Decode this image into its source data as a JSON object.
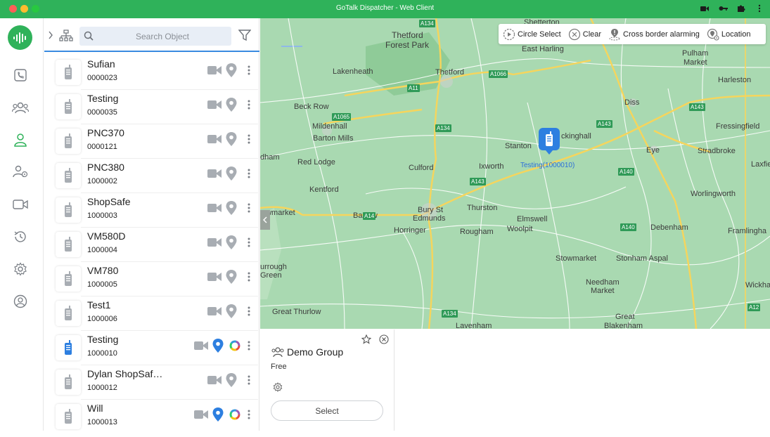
{
  "window": {
    "title": "GoTalk Dispatcher - Web Client"
  },
  "search": {
    "placeholder": "Search Object"
  },
  "objects": [
    {
      "name": "Sufian",
      "id": "0000023",
      "online": false
    },
    {
      "name": "Testing",
      "id": "0000035",
      "online": false
    },
    {
      "name": "PNC370",
      "id": "0000121",
      "online": false
    },
    {
      "name": "PNC380",
      "id": "1000002",
      "online": false
    },
    {
      "name": "ShopSafe",
      "id": "1000003",
      "online": false
    },
    {
      "name": "VM580D",
      "id": "1000004",
      "online": false
    },
    {
      "name": "VM780",
      "id": "1000005",
      "online": false
    },
    {
      "name": "Test1",
      "id": "1000006",
      "online": false
    },
    {
      "name": "Testing",
      "id": "1000010",
      "online": true
    },
    {
      "name": "Dylan ShopSaf…",
      "id": "1000012",
      "online": false
    },
    {
      "name": "Will",
      "id": "1000013",
      "online": true
    }
  ],
  "map_toolbar": {
    "circle_select": "Circle Select",
    "clear": "Clear",
    "cross_border": "Cross border alarming",
    "location": "Location"
  },
  "map_marker": {
    "label": "Testing(1000010)"
  },
  "map_places": [
    "Shetterton",
    "Thetford",
    "Forest Park",
    "East Harling",
    "Pulham",
    "Market",
    "Lakenheath",
    "Thetford",
    "Harleston",
    "Beck Row",
    "Diss",
    "Mildenhall",
    "Barton Mills",
    "Fressingfield",
    "Stanton",
    "ckinghall",
    "Eye",
    "Stradbroke",
    "dham",
    "Red Lodge",
    "Culford",
    "Ixworth",
    "Laxfie",
    "Kentford",
    "Worlingworth",
    "Barrow",
    "Thurston",
    "Bury St",
    "Edmunds",
    "Elmswell",
    "ewmarket",
    "Horringer",
    "Rougham",
    "Woolpit",
    "Debenham",
    "Framlingha",
    "Stowmarket",
    "Stonham Aspal",
    "urrough",
    "Green",
    "Needham",
    "Market",
    "Wickha",
    "Great Thurlow",
    "Great",
    "Blakenham",
    "Lavenham"
  ],
  "map_roads": [
    "A134",
    "A1066",
    "A11",
    "A1065",
    "A134",
    "A143",
    "A143",
    "A143",
    "A140",
    "A14",
    "A140",
    "A134",
    "A12"
  ],
  "group_card": {
    "name": "Demo Group",
    "status": "Free",
    "select_label": "Select"
  },
  "colors": {
    "brand": "#2fb25a",
    "accent": "#3a8ae0",
    "map": "#a8d8b0",
    "marker": "#2d7fe0"
  }
}
